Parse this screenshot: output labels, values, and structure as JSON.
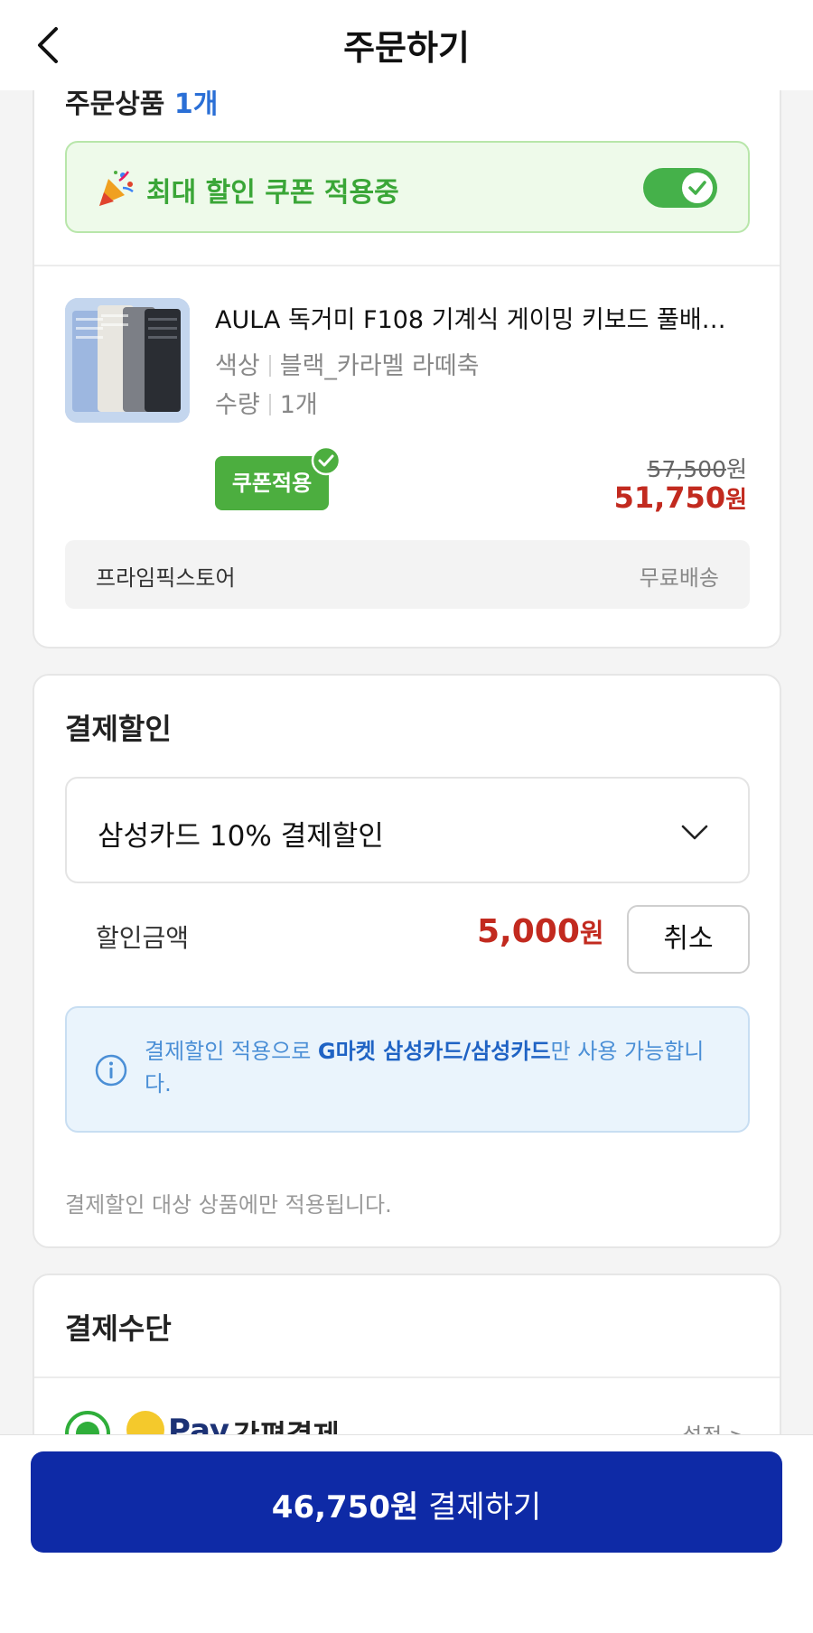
{
  "header": {
    "title": "주문하기",
    "back_icon": "chevron-left-icon"
  },
  "order": {
    "title": "주문상품",
    "count": "1개",
    "coupon_banner": {
      "text": "최대 할인 쿠폰 적용중",
      "toggle_on": true,
      "accent": "#45b14a"
    },
    "product": {
      "name": "AULA 독거미 F108 기계식 게이밍 키보드 풀배…",
      "options": [
        {
          "label": "색상",
          "value": "블랙_카라멜 라떼축"
        },
        {
          "label": "수량",
          "value": "1개"
        }
      ],
      "coupon_badge": "쿠폰적용",
      "original_price": "57,500",
      "final_price": "51,750",
      "currency": "원"
    },
    "seller": {
      "name": "프라임픽스토어",
      "shipping": "무료배송"
    }
  },
  "payment_discount": {
    "title": "결제할인",
    "selected_option": "삼성카드 10% 결제할인",
    "amount_label": "할인금액",
    "amount": "5,000",
    "currency": "원",
    "cancel_label": "취소",
    "info_prefix": "결제할인 적용으로 ",
    "info_highlight": "G마켓 삼성카드/삼성카드",
    "info_suffix": "만 사용 가능합니다.",
    "footnote": "결제할인 대상 상품에만 적용됩니다."
  },
  "payment_method": {
    "title": "결제수단",
    "option_brand": "Pay",
    "option_label": "간편결제",
    "settings_label": "설정 >"
  },
  "pay_button": {
    "amount": "46,750원",
    "label": " 결제하기",
    "color": "#0e2aa6"
  }
}
